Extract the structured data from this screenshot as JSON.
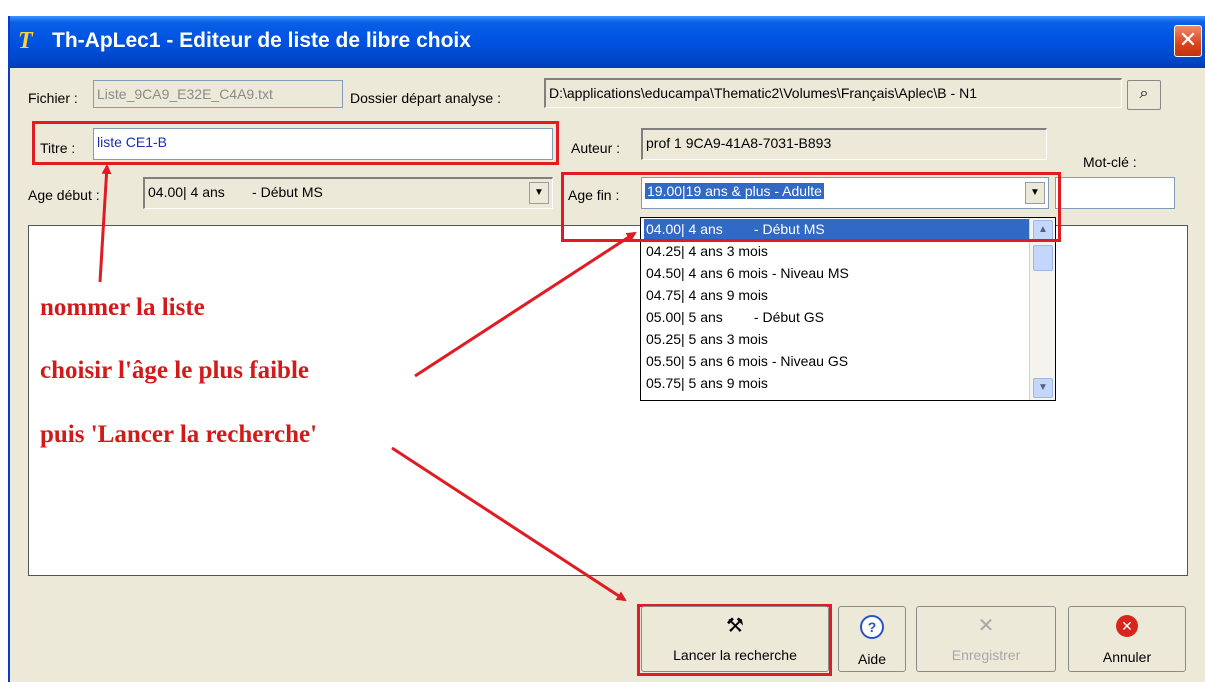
{
  "window": {
    "title": "Th-ApLec1 - Editeur de liste de libre choix",
    "icon_glyph": "T",
    "close_glyph": "✕"
  },
  "form": {
    "fichier_label": "Fichier :",
    "fichier_value": "Liste_9CA9_E32E_C4A9.txt",
    "dossier_label": "Dossier départ analyse :",
    "dossier_value": "D:\\applications\\educampa\\Thematic2\\Volumes\\Français\\Aplec\\B - N1",
    "titre_label": "Titre :",
    "titre_value": "liste CE1-B",
    "auteur_label": "Auteur :",
    "auteur_value": "prof 1 9CA9-41A8-7031-B893",
    "motcle_label": "Mot-clé :",
    "motcle_value": "",
    "age_debut_label": "Age début :",
    "age_debut_value": "04.00| 4 ans       - Début MS",
    "age_fin_label": "Age fin :",
    "age_fin_value": "19.00|19 ans & plus - Adulte"
  },
  "dropdown": {
    "items": [
      "04.00| 4 ans        - Début MS",
      "04.25| 4 ans 3 mois",
      "04.50| 4 ans 6 mois - Niveau MS",
      "04.75| 4 ans 9 mois",
      "05.00| 5 ans        - Début GS",
      "05.25| 5 ans 3 mois",
      "05.50| 5 ans 6 mois - Niveau GS",
      "05.75| 5 ans 9 mois"
    ],
    "selected_index": 0
  },
  "annotations": {
    "line1": "nommer la liste",
    "line2": "choisir l'âge le plus faible",
    "line3": "puis 'Lancer la recherche'"
  },
  "buttons": {
    "lancer": "Lancer la recherche",
    "aide": "Aide",
    "enregistrer": "Enregistrer",
    "annuler": "Annuler"
  },
  "icons": {
    "lancer": "hammer-wrench-icon",
    "aide": "help-question-icon",
    "enregistrer": "x-icon",
    "annuler": "cancel-circle-icon",
    "browse": "folder-browse-icon"
  },
  "colors": {
    "annotation_red": "#d31a1a",
    "titlebar_blue": "#0054e3",
    "selection_blue": "#316ac5"
  }
}
